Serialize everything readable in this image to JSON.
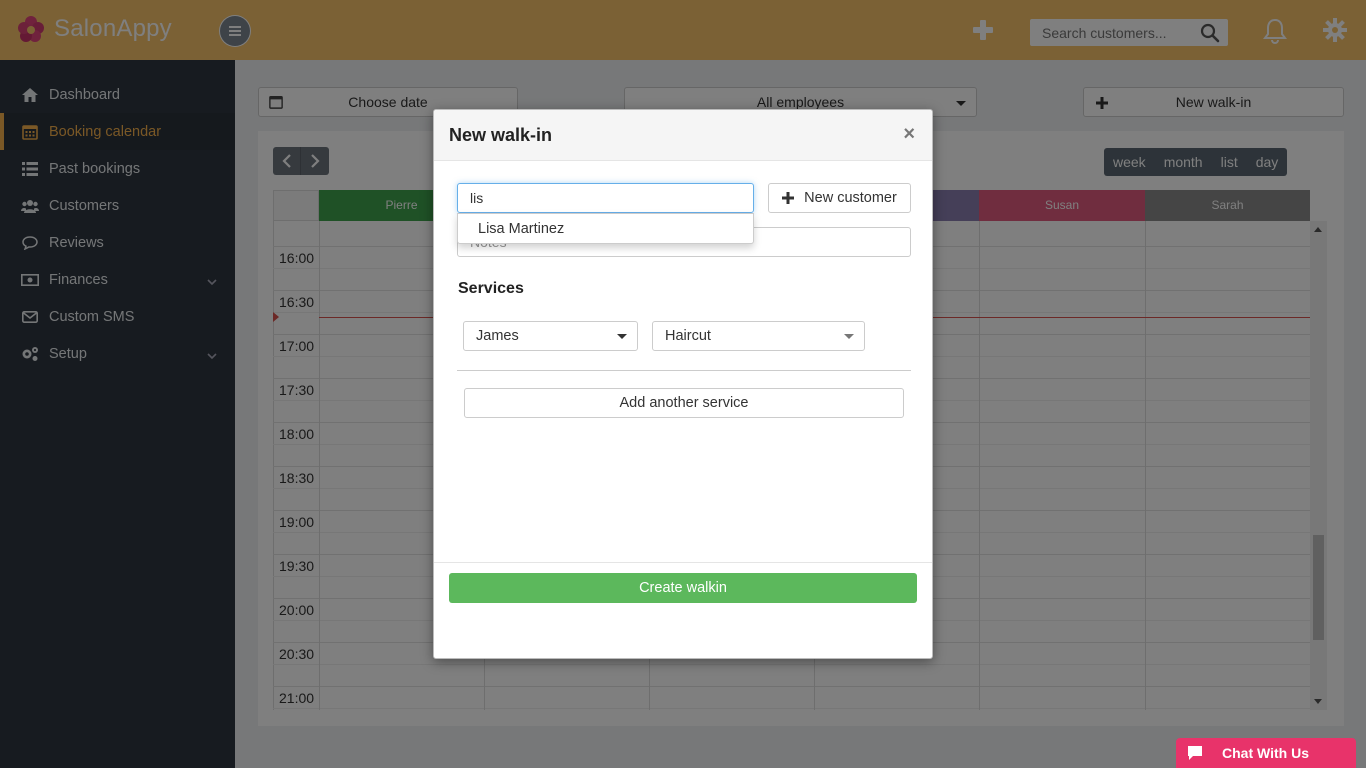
{
  "app": {
    "name": "SalonAppy"
  },
  "topbar": {
    "search_placeholder": "Search customers..."
  },
  "sidebar": {
    "items": [
      {
        "label": "Dashboard",
        "icon": "home-icon"
      },
      {
        "label": "Booking calendar",
        "icon": "calendar-icon",
        "active": true
      },
      {
        "label": "Past bookings",
        "icon": "list-icon"
      },
      {
        "label": "Customers",
        "icon": "users-icon"
      },
      {
        "label": "Reviews",
        "icon": "comment-icon"
      },
      {
        "label": "Finances",
        "icon": "money-icon",
        "has_submenu": true
      },
      {
        "label": "Custom SMS",
        "icon": "envelope-icon"
      },
      {
        "label": "Setup",
        "icon": "cogs-icon",
        "has_submenu": true
      }
    ]
  },
  "toolbar": {
    "choose_date": "Choose date",
    "employees_select": "All employees",
    "new_walkin": "New walk-in"
  },
  "calendar": {
    "views": [
      "day",
      "week",
      "month",
      "list",
      "day"
    ],
    "selected_view": 0,
    "columns": [
      {
        "name": "Pierre",
        "color": "#3fa34d"
      },
      {
        "name": "",
        "color": "#8a7fb0"
      },
      {
        "name": "",
        "color": "#8a7fb0"
      },
      {
        "name": "",
        "color": "#8a7fb0"
      },
      {
        "name": "Susan",
        "color": "#e05b7f"
      },
      {
        "name": "Sarah",
        "color": "#8a8a8a"
      }
    ],
    "times": [
      "16:00",
      "16:30",
      "17:00",
      "17:30",
      "18:00",
      "18:30",
      "19:00",
      "19:30",
      "20:00",
      "20:30",
      "21:00"
    ]
  },
  "modal": {
    "title": "New walk-in",
    "close": "×",
    "customer_input_value": "lis",
    "new_customer_label": "New customer",
    "notes_placeholder": "Notes",
    "suggestion": "Lisa Martinez",
    "services_title": "Services",
    "employee_select": "James",
    "service_select": "Haircut",
    "add_service": "Add another service",
    "create_button": "Create walkin"
  },
  "chat": {
    "label": "Chat With Us"
  },
  "colors": {
    "topbar": "#f6c26b",
    "accent": "#f5b04c",
    "primary_green": "#5cb85c",
    "chat": "#e8336a"
  }
}
